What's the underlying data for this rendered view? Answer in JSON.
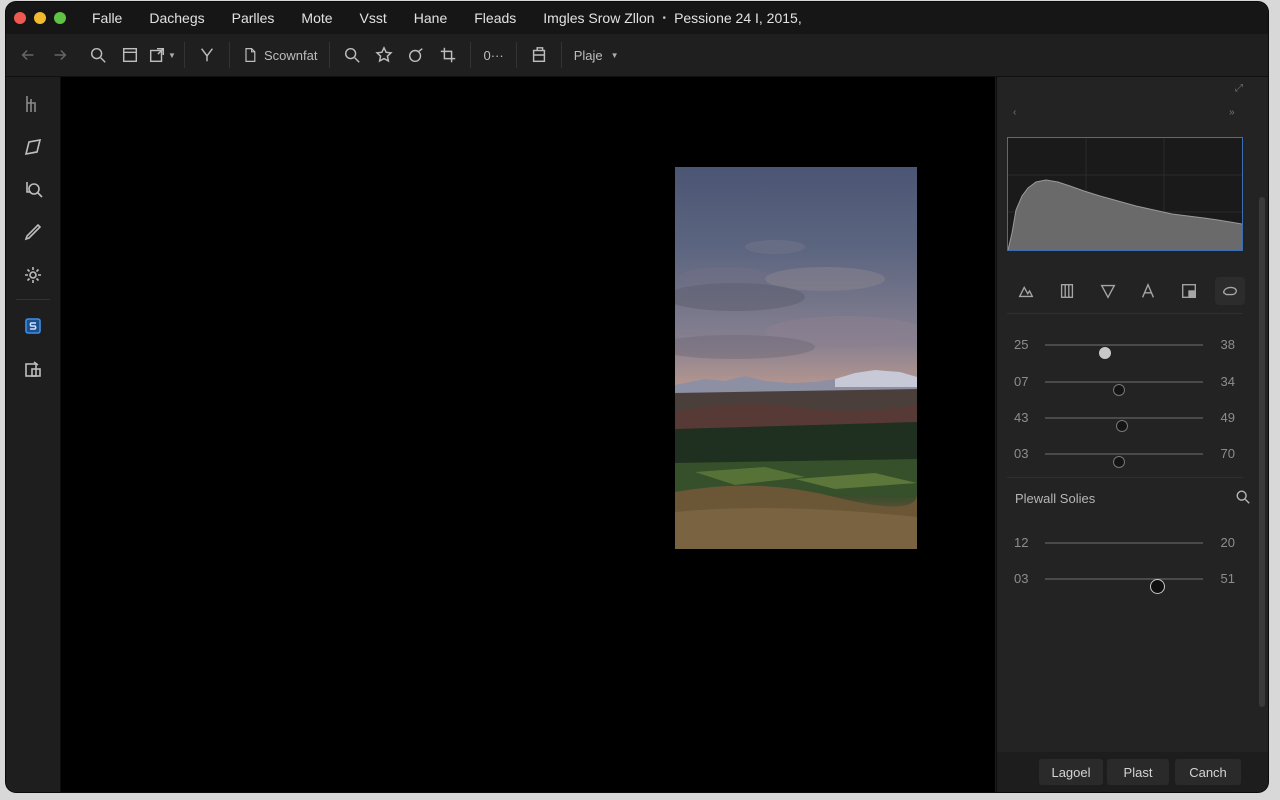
{
  "menubar": {
    "items": [
      "Falle",
      "Dachegs",
      "Parlles",
      "Mote",
      "Vsst",
      "Hane",
      "Fleads"
    ],
    "document_title": "Imgles Srow Zllon",
    "title_info": "Pessione 24 I, 2015,"
  },
  "toolbar": {
    "back_icon": "arrow-left-icon",
    "forward_icon": "arrow-right-icon",
    "screenshot_label": "Scownfat",
    "counter_label": "0···",
    "profile_label": "Plaje"
  },
  "panel": {
    "sliders_top": [
      {
        "left": "25",
        "right": "38",
        "level": 0.38
      },
      {
        "left": "07",
        "right": "34",
        "level": 0.47
      },
      {
        "left": "43",
        "right": "49",
        "level": 0.49
      },
      {
        "left": "03",
        "right": "70",
        "level": 0.47
      }
    ],
    "section_title": "Plewall Solies",
    "sliders_bottom": [
      {
        "left": "12",
        "right": "20",
        "level": null
      },
      {
        "left": "03",
        "right": "51",
        "level": 0.71
      }
    ]
  },
  "footer": {
    "buttons": [
      "Lagoel",
      "Plast",
      "Canch"
    ]
  },
  "colors": {
    "accent": "#3a6fb4",
    "window_bg": "#1c1c1c",
    "canvas_bg": "#000000"
  }
}
